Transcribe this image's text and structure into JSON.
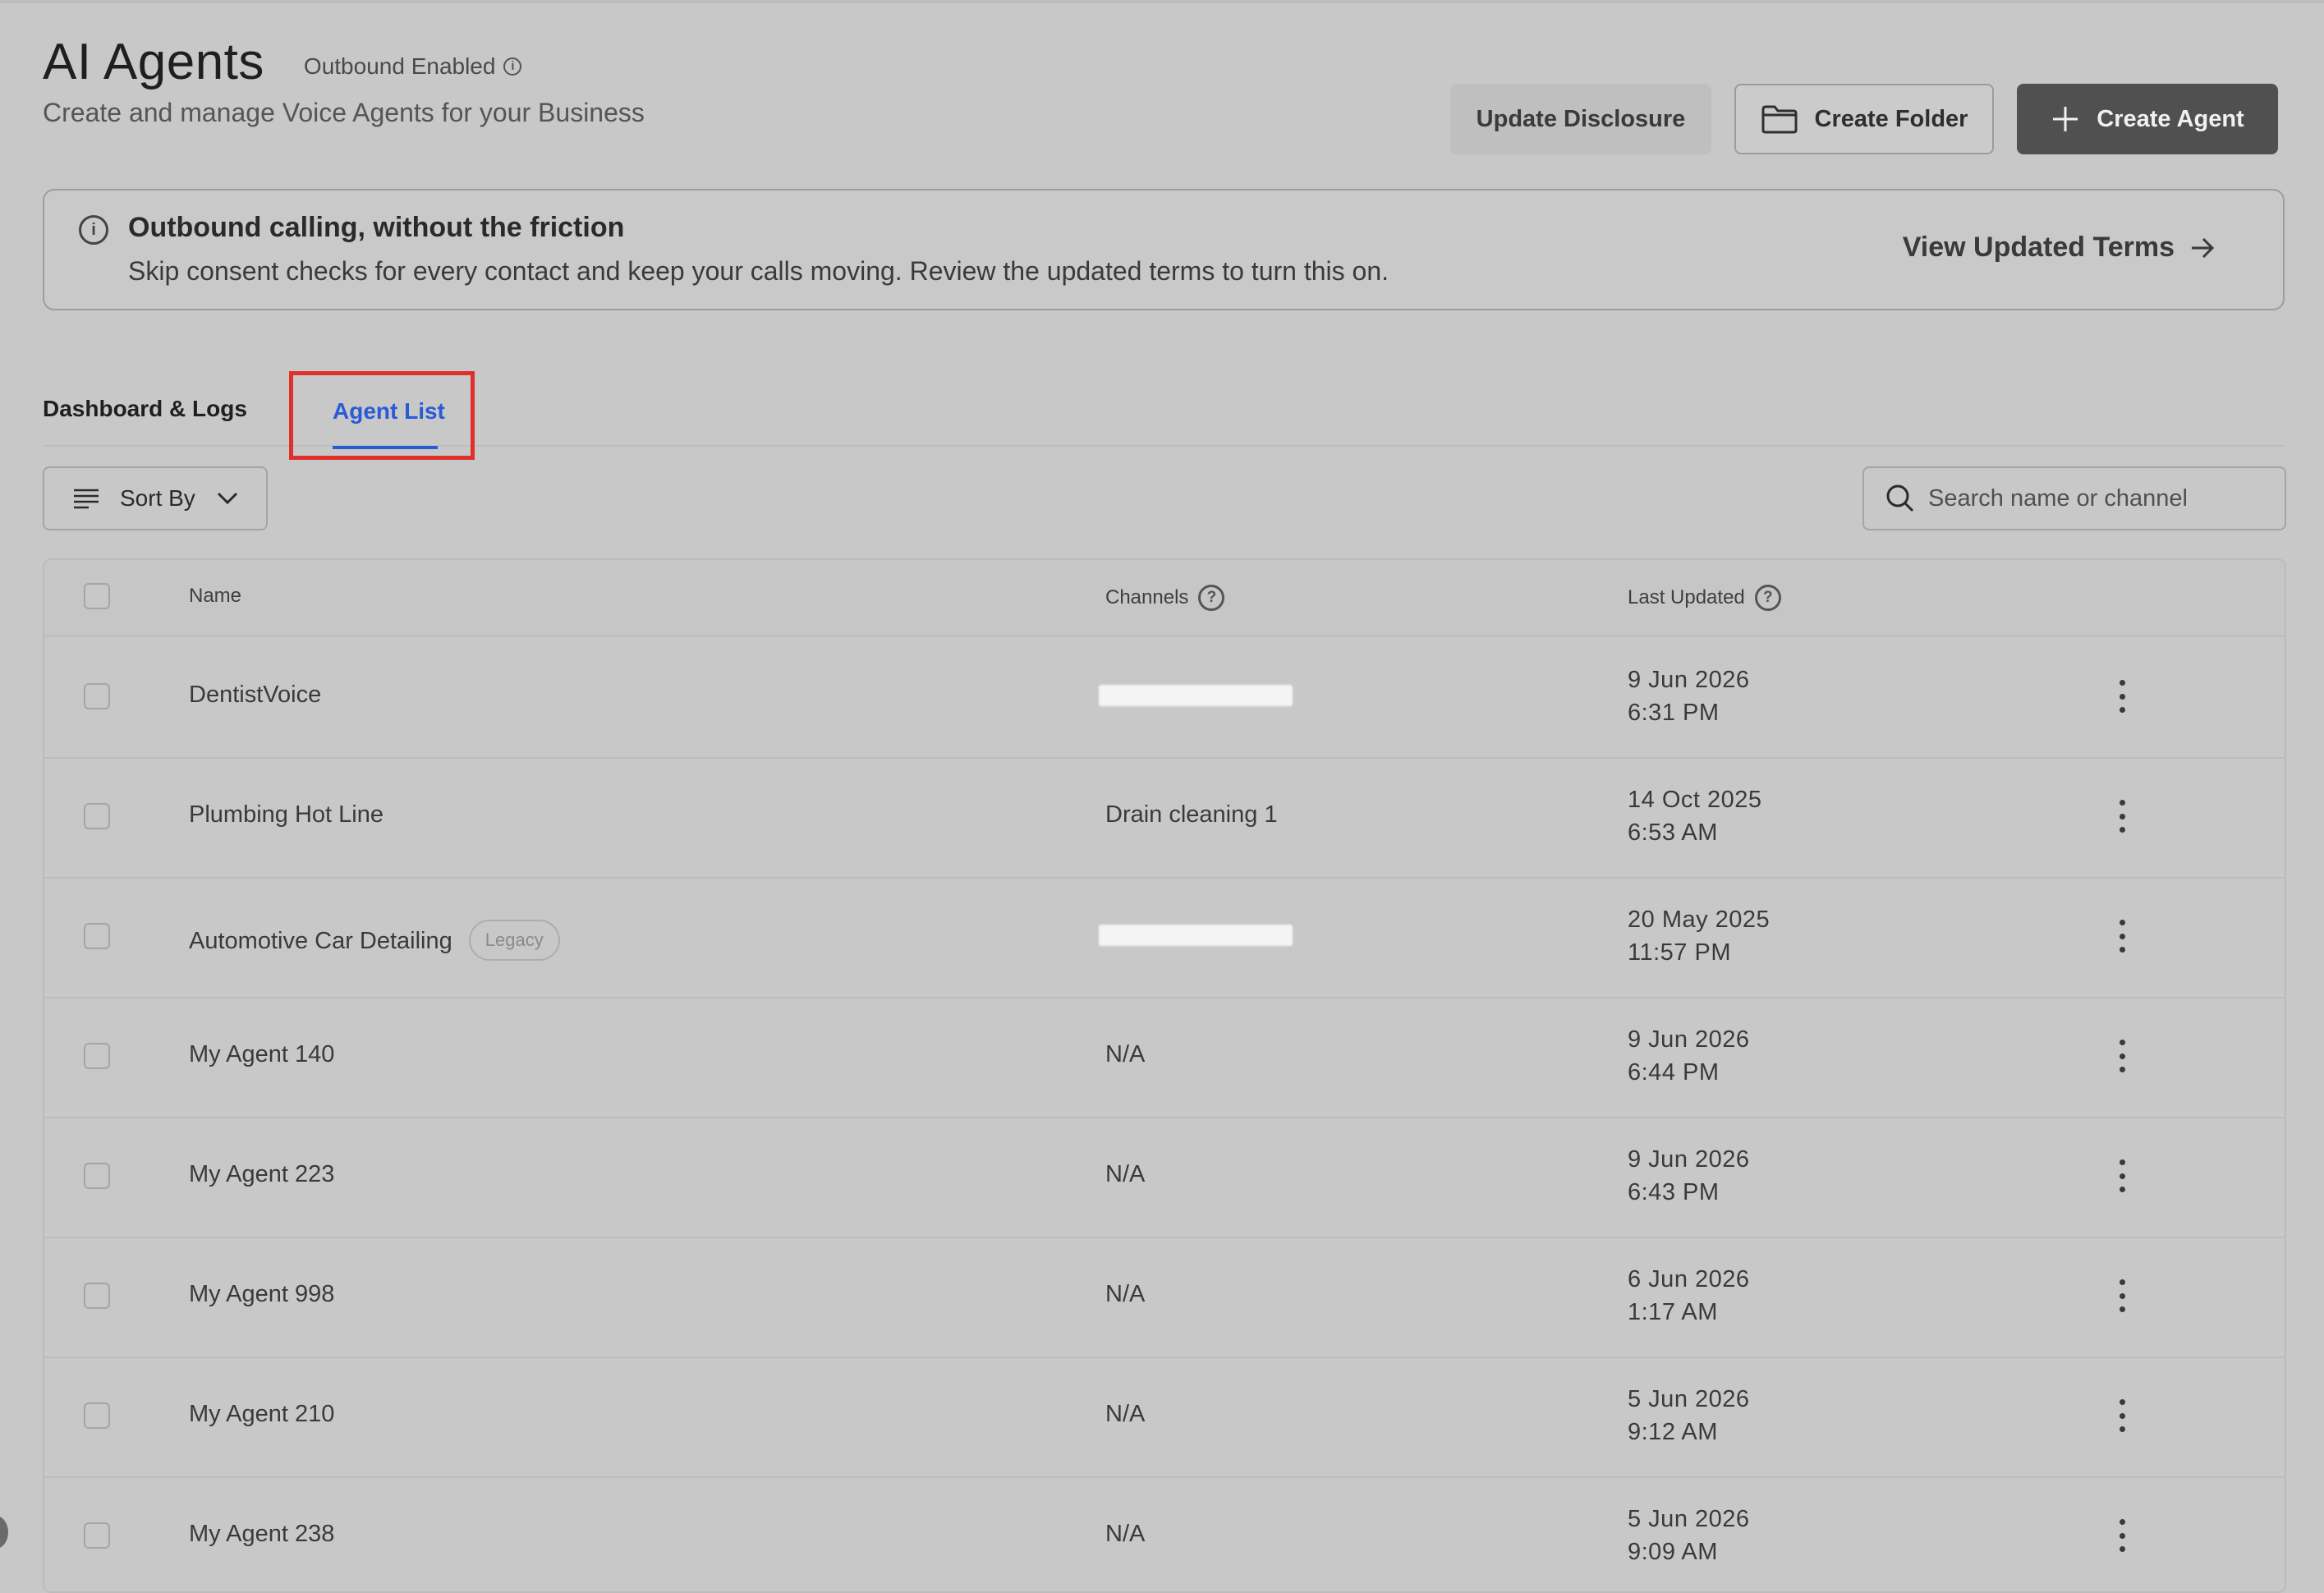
{
  "header": {
    "title": "AI Agents",
    "outbound_status": "Outbound Enabled",
    "subtitle": "Create and manage Voice Agents for your Business"
  },
  "actions": {
    "update_disclosure": "Update Disclosure",
    "create_folder": "Create Folder",
    "create_agent": "Create Agent"
  },
  "banner": {
    "title": "Outbound calling, without the friction",
    "text": "Skip consent checks for every contact and keep your calls moving. Review the updated terms to turn this on.",
    "link": "View Updated Terms"
  },
  "tabs": {
    "dashboard": "Dashboard & Logs",
    "agent_list": "Agent List",
    "active": "agent_list"
  },
  "toolbar": {
    "sort_label": "Sort By",
    "search_placeholder": "Search name or channel"
  },
  "table": {
    "columns": {
      "name": "Name",
      "channels": "Channels",
      "last_updated": "Last Updated"
    },
    "rows": [
      {
        "name": "DentistVoice",
        "channel": "",
        "channel_redacted": true,
        "date": "9 Jun 2026",
        "time": "6:31 PM"
      },
      {
        "name": "Plumbing Hot Line",
        "channel": "Drain cleaning 1",
        "channel_redacted": false,
        "date": "14 Oct 2025",
        "time": "6:53 AM"
      },
      {
        "name": "Automotive Car Detailing",
        "badge": "Legacy",
        "channel": "",
        "channel_redacted": true,
        "date": "20 May 2025",
        "time": "11:57 PM"
      },
      {
        "name": "My Agent 140",
        "channel": "N/A",
        "channel_redacted": false,
        "date": "9 Jun 2026",
        "time": "6:44 PM"
      },
      {
        "name": "My Agent 223",
        "channel": "N/A",
        "channel_redacted": false,
        "date": "9 Jun 2026",
        "time": "6:43 PM"
      },
      {
        "name": "My Agent 998",
        "channel": "N/A",
        "channel_redacted": false,
        "date": "6 Jun 2026",
        "time": "1:17 AM"
      },
      {
        "name": "My Agent 210",
        "channel": "N/A",
        "channel_redacted": false,
        "date": "5 Jun 2026",
        "time": "9:12 AM"
      },
      {
        "name": "My Agent 238",
        "channel": "N/A",
        "channel_redacted": false,
        "date": "5 Jun 2026",
        "time": "9:09 AM"
      }
    ]
  },
  "colors": {
    "background": "#c8c8c8",
    "active_tab": "#2a5bd7",
    "highlight_box": "#e0302a",
    "primary_button": "#505050"
  }
}
